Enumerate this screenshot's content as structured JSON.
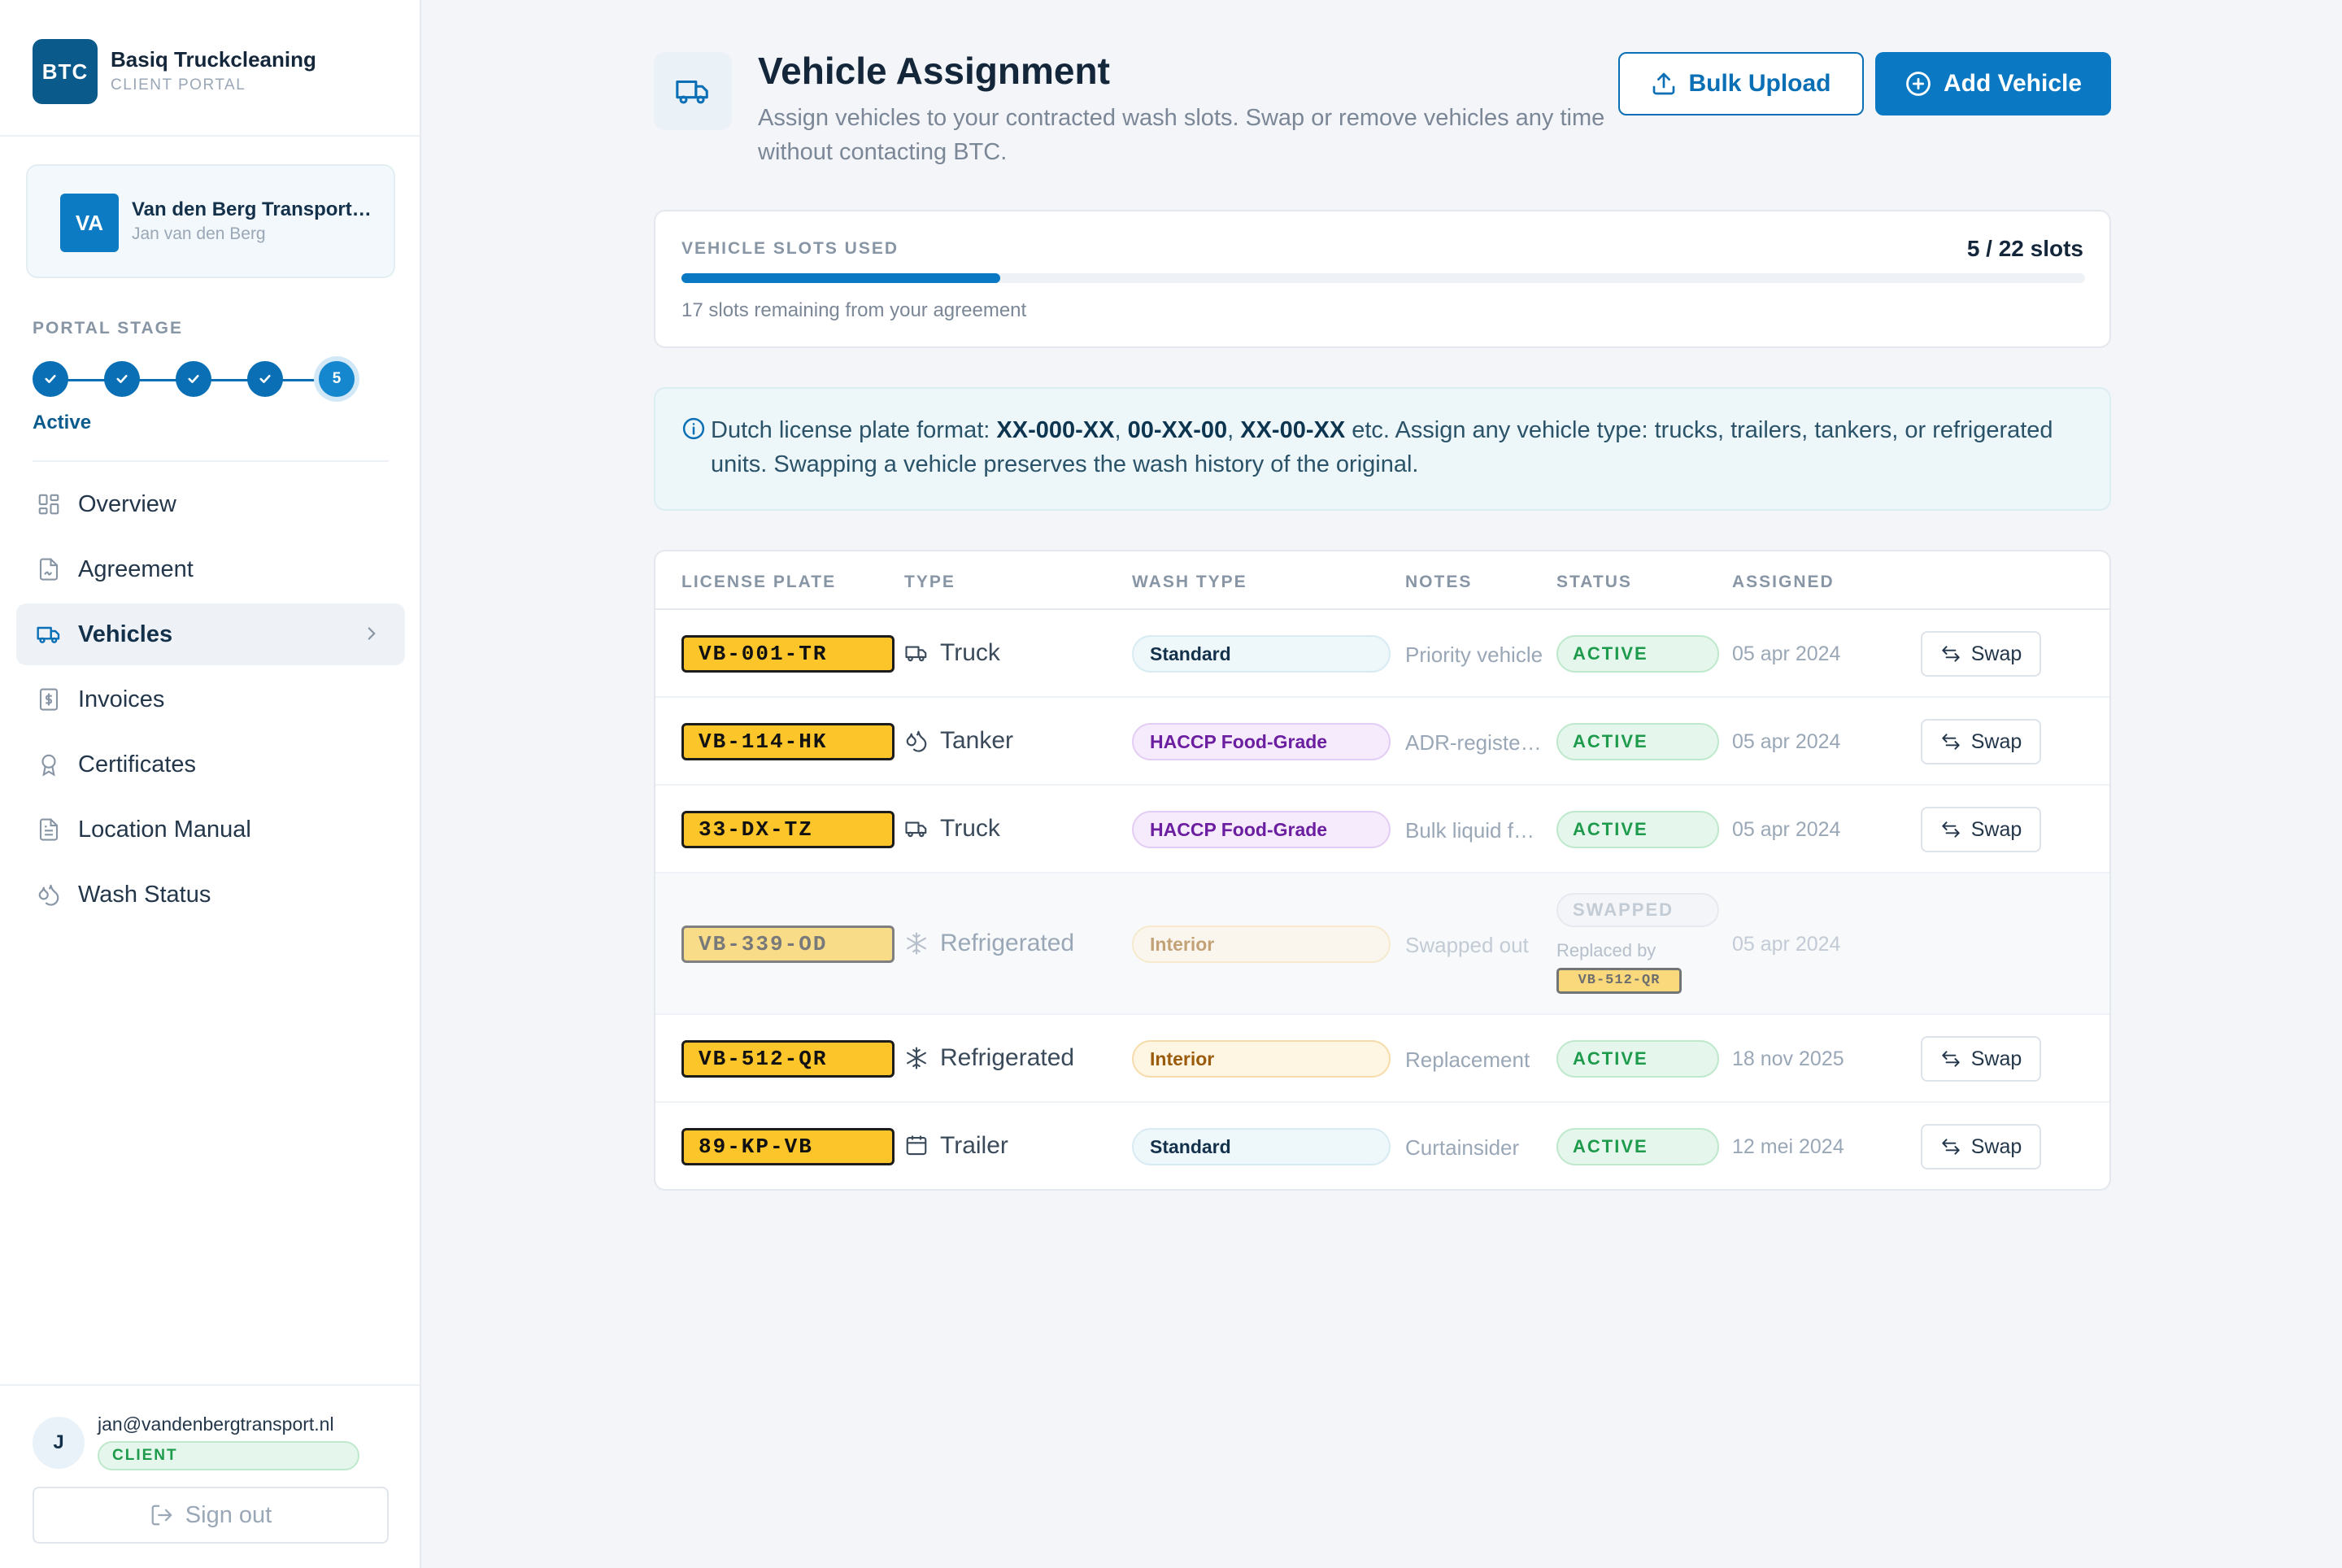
{
  "brand": {
    "logo": "BTC",
    "name": "Basiq Truckcleaning",
    "subtitle": "CLIENT PORTAL"
  },
  "client": {
    "initials": "VA",
    "company": "Van den Berg Transport B.V.",
    "person": "Jan van den Berg"
  },
  "portal_stage": {
    "label": "PORTAL STAGE",
    "steps": [
      "done",
      "done",
      "done",
      "done",
      "5"
    ],
    "current_step": 5,
    "status": "Active"
  },
  "nav": {
    "items": [
      {
        "label": "Overview",
        "icon": "grid-icon"
      },
      {
        "label": "Agreement",
        "icon": "document-signed-icon"
      },
      {
        "label": "Vehicles",
        "icon": "truck-icon",
        "active": true
      },
      {
        "label": "Invoices",
        "icon": "dollar-document-icon"
      },
      {
        "label": "Certificates",
        "icon": "award-icon"
      },
      {
        "label": "Location Manual",
        "icon": "file-text-icon"
      },
      {
        "label": "Wash Status",
        "icon": "droplets-icon"
      }
    ]
  },
  "user": {
    "initial": "J",
    "email": "jan@vandenbergtransport.nl",
    "role": "CLIENT",
    "signout_label": "Sign out"
  },
  "header": {
    "title": "Vehicle Assignment",
    "subtitle": "Assign vehicles to your contracted wash slots. Swap or remove vehicles any time without contacting BTC.",
    "bulk_upload_label": "Bulk Upload",
    "add_vehicle_label": "Add Vehicle"
  },
  "slots": {
    "label": "VEHICLE SLOTS USED",
    "count_text": "5 / 22 slots",
    "used": 5,
    "total": 22,
    "remaining_text": "17 slots remaining from your agreement"
  },
  "info": {
    "prefix": "Dutch license plate format: ",
    "formats": [
      "XX-000-XX",
      "00-XX-00",
      "XX-00-XX"
    ],
    "sep1": ", ",
    "sep2": ", ",
    "suffix": " etc. Assign any vehicle type: trucks, trailers, tankers, or refrigerated units. Swapping a vehicle preserves the wash history of the original."
  },
  "table": {
    "columns": [
      "LICENSE PLATE",
      "TYPE",
      "WASH TYPE",
      "NOTES",
      "STATUS",
      "ASSIGNED"
    ],
    "rows": [
      {
        "plate": "VB-001-TR",
        "type": "Truck",
        "type_icon": "truck-icon",
        "wash": "Standard",
        "wash_style": "standard",
        "notes": "Priority vehicle",
        "status": "ACTIVE",
        "assigned": "05 apr 2024",
        "action": "Swap"
      },
      {
        "plate": "VB-114-HK",
        "type": "Tanker",
        "type_icon": "droplets-icon",
        "wash": "HACCP Food-Grade",
        "wash_style": "haccp",
        "notes": "ADR-registered",
        "status": "ACTIVE",
        "assigned": "05 apr 2024",
        "action": "Swap"
      },
      {
        "plate": "33-DX-TZ",
        "type": "Truck",
        "type_icon": "truck-icon",
        "wash": "HACCP Food-Grade",
        "wash_style": "haccp",
        "notes": "Bulk liquid food",
        "status": "ACTIVE",
        "assigned": "05 apr 2024",
        "action": "Swap"
      },
      {
        "plate": "VB-339-OD",
        "type": "Refrigerated",
        "type_icon": "snowflake-icon",
        "wash": "Interior",
        "wash_style": "interior",
        "notes": "Swapped out",
        "status": "SWAPPED",
        "replaced_label": "Replaced by",
        "replaced_plate": "VB-512-QR",
        "assigned": "05 apr 2024",
        "action": ""
      },
      {
        "plate": "VB-512-QR",
        "type": "Refrigerated",
        "type_icon": "snowflake-icon",
        "wash": "Interior",
        "wash_style": "interior",
        "notes": "Replacement",
        "status": "ACTIVE",
        "assigned": "18 nov 2025",
        "action": "Swap"
      },
      {
        "plate": "89-KP-VB",
        "type": "Trailer",
        "type_icon": "trailer-icon",
        "wash": "Standard",
        "wash_style": "standard",
        "notes": "Curtainsider",
        "status": "ACTIVE",
        "assigned": "12 mei 2024",
        "action": "Swap"
      }
    ]
  },
  "colors": {
    "primary": "#0a78c2",
    "plate_yellow": "#fcc52a",
    "active_green": "#1d9a4b",
    "haccp_purple": "#6b1fa0",
    "interior_amber": "#9a5b0c"
  }
}
